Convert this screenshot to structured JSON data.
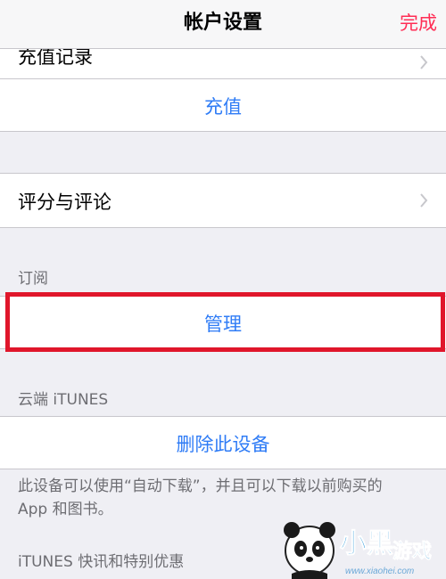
{
  "nav": {
    "title": "帐户设置",
    "done_label": "完成"
  },
  "rows": {
    "recharge_record": "充值记录",
    "recharge": "充值",
    "ratings": "评分与评论",
    "subscriptions_header": "订阅",
    "manage": "管理",
    "itunes_cloud_header": "云端 iTUNES",
    "remove_device": "删除此设备",
    "remove_device_note_line1": "此设备可以使用“自动下载”，并且可以下载以前购买的",
    "remove_device_note_line2": "App 和图书。",
    "newsletter_header": "iTUNES 快讯和特别优惠"
  },
  "watermark": {
    "text": "小黑游戏",
    "url": "www.xiaohei.com"
  },
  "colors": {
    "ios_blue": "#2f7cf6",
    "ios_pink": "#ff2d55",
    "highlight_red": "#e0162b",
    "group_bg": "#efeff4"
  }
}
